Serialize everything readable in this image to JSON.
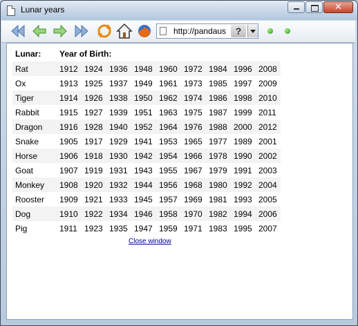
{
  "window": {
    "title": "Lunar years"
  },
  "toolbar": {
    "address": "http://pandaus",
    "help_label": "?",
    "buttons": [
      "back-first-icon",
      "back-icon",
      "forward-icon",
      "forward-last-icon",
      "refresh-icon",
      "home-icon",
      "firefox-icon"
    ]
  },
  "table": {
    "col_lunar": "Lunar:",
    "col_year": "Year of Birth:",
    "rows": [
      {
        "name": "Rat",
        "years": [
          "1912",
          "1924",
          "1936",
          "1948",
          "1960",
          "1972",
          "1984",
          "1996",
          "2008"
        ]
      },
      {
        "name": "Ox",
        "years": [
          "1913",
          "1925",
          "1937",
          "1949",
          "1961",
          "1973",
          "1985",
          "1997",
          "2009"
        ]
      },
      {
        "name": "Tiger",
        "years": [
          "1914",
          "1926",
          "1938",
          "1950",
          "1962",
          "1974",
          "1986",
          "1998",
          "2010"
        ]
      },
      {
        "name": "Rabbit",
        "years": [
          "1915",
          "1927",
          "1939",
          "1951",
          "1963",
          "1975",
          "1987",
          "1999",
          "2011"
        ]
      },
      {
        "name": "Dragon",
        "years": [
          "1916",
          "1928",
          "1940",
          "1952",
          "1964",
          "1976",
          "1988",
          "2000",
          "2012"
        ]
      },
      {
        "name": "Snake",
        "years": [
          "1905",
          "1917",
          "1929",
          "1941",
          "1953",
          "1965",
          "1977",
          "1989",
          "2001"
        ]
      },
      {
        "name": "Horse",
        "years": [
          "1906",
          "1918",
          "1930",
          "1942",
          "1954",
          "1966",
          "1978",
          "1990",
          "2002"
        ]
      },
      {
        "name": "Goat",
        "years": [
          "1907",
          "1919",
          "1931",
          "1943",
          "1955",
          "1967",
          "1979",
          "1991",
          "2003"
        ]
      },
      {
        "name": "Monkey",
        "years": [
          "1908",
          "1920",
          "1932",
          "1944",
          "1956",
          "1968",
          "1980",
          "1992",
          "2004"
        ]
      },
      {
        "name": "Rooster",
        "years": [
          "1909",
          "1921",
          "1933",
          "1945",
          "1957",
          "1969",
          "1981",
          "1993",
          "2005"
        ]
      },
      {
        "name": "Dog",
        "years": [
          "1910",
          "1922",
          "1934",
          "1946",
          "1958",
          "1970",
          "1982",
          "1994",
          "2006"
        ]
      },
      {
        "name": "Pig",
        "years": [
          "1911",
          "1923",
          "1935",
          "1947",
          "1959",
          "1971",
          "1983",
          "1995",
          "2007"
        ]
      }
    ]
  },
  "close_link": "Close window"
}
